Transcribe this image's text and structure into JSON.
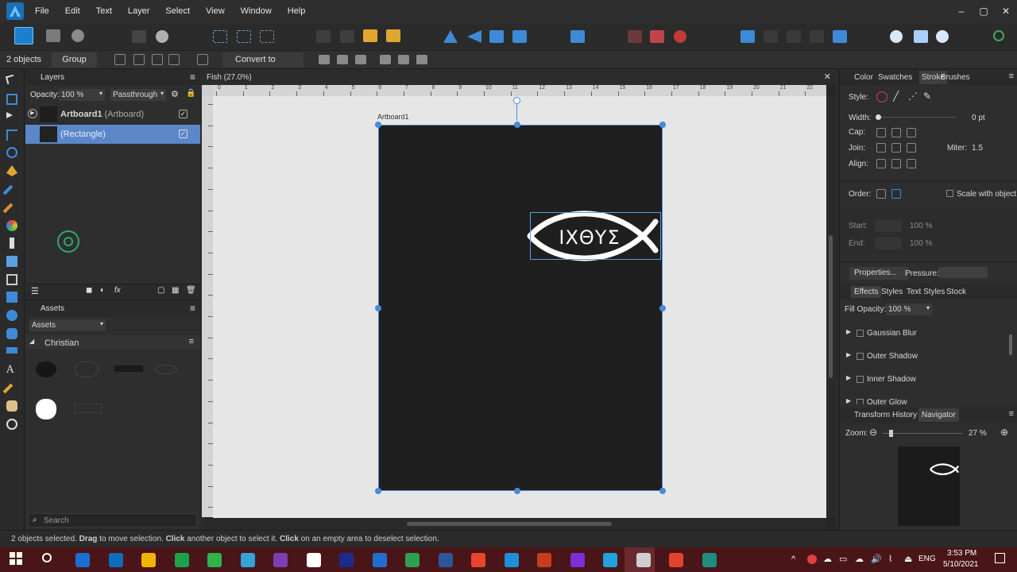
{
  "menubar": {
    "items": [
      "File",
      "Edit",
      "Text",
      "Layer",
      "Select",
      "View",
      "Window",
      "Help"
    ],
    "window_controls": [
      "–",
      "▢",
      "✕"
    ]
  },
  "context_toolbar": {
    "selection_count": "2 objects",
    "group_label": "Group",
    "convert_label": "Convert to Curves"
  },
  "layers_panel": {
    "tab": "Layers",
    "opacity_label": "Opacity:",
    "opacity_value": "100 %",
    "blend_mode": "Passthrough",
    "rows": [
      {
        "name": "Artboard1",
        "type": "(Artboard)"
      },
      {
        "name": "(Rectangle)"
      }
    ]
  },
  "assets_panel": {
    "tab": "Assets",
    "dropdown": "Assets",
    "category": "Christian"
  },
  "document": {
    "tab_title": "Fish (27.0%)",
    "artboard_label": "Artboard1",
    "ruler_labels": [
      "0",
      "1",
      "2",
      "3",
      "4",
      "5",
      "6",
      "7",
      "8",
      "9",
      "10",
      "11",
      "12",
      "13",
      "14",
      "15",
      "16",
      "17",
      "18",
      "19",
      "20",
      "21",
      "22"
    ],
    "symbol_text": "ΙΧΘΥΣ"
  },
  "stroke_panel": {
    "tabs": [
      "Color",
      "Swatches",
      "Stroke",
      "Brushes"
    ],
    "active_tab": "Stroke",
    "style_label": "Style:",
    "width_label": "Width:",
    "width_value": "0 pt",
    "cap_label": "Cap:",
    "join_label": "Join:",
    "miter_label": "Miter:",
    "miter_value": "1.5",
    "align_label": "Align:",
    "order_label": "Order:",
    "scale_label": "Scale with object",
    "start_label": "Start:",
    "end_label": "End:",
    "start_pct": "100 %",
    "end_pct": "100 %",
    "properties_btn": "Properties...",
    "pressure_label": "Pressure:"
  },
  "effects_panel": {
    "tabs": [
      "Effects",
      "Styles",
      "Text Styles",
      "Stock"
    ],
    "fill_opacity_label": "Fill Opacity:",
    "fill_opacity_value": "100 %",
    "effects": [
      "Gaussian Blur",
      "Outer Shadow",
      "Inner Shadow",
      "Outer Glow"
    ]
  },
  "navigator_panel": {
    "tabs": [
      "Transform",
      "History",
      "Navigator"
    ],
    "zoom_label": "Zoom:",
    "zoom_value": "27 %"
  },
  "statusbar": {
    "segments": [
      {
        "text": "2 objects selected. ",
        "bold": false
      },
      {
        "text": "Drag",
        "bold": true
      },
      {
        "text": " to move selection. ",
        "bold": false
      },
      {
        "text": "Click",
        "bold": true
      },
      {
        "text": " another object to select it. ",
        "bold": false
      },
      {
        "text": "Click",
        "bold": true
      },
      {
        "text": " on an empty area to deselect selection.",
        "bold": false
      }
    ]
  },
  "search": {
    "placeholder": "Search"
  },
  "taskbar": {
    "language": "ENG",
    "time": "3:53 PM",
    "date": "5/10/2021",
    "app_colors": [
      "#1b6fd1",
      "#0f6cbd",
      "#f0b400",
      "#1aa34a",
      "#2fb34a",
      "#33a3d8",
      "#7c3fb3",
      "#ffffff",
      "#1c2c8c",
      "#1f6fd1",
      "#2e9e4f",
      "#2b579a",
      "#e8452c",
      "#1f8fd8",
      "#c43e1c",
      "#7a2fd8",
      "#24a1de",
      "#cfcfcf",
      "#e2432a",
      "#1e8c7e"
    ]
  },
  "colors": {
    "accent": "#4a8ad8",
    "artboard": "#1f1f1f",
    "selection_row": "#5b87c8",
    "taskbar": "#4a1518"
  }
}
